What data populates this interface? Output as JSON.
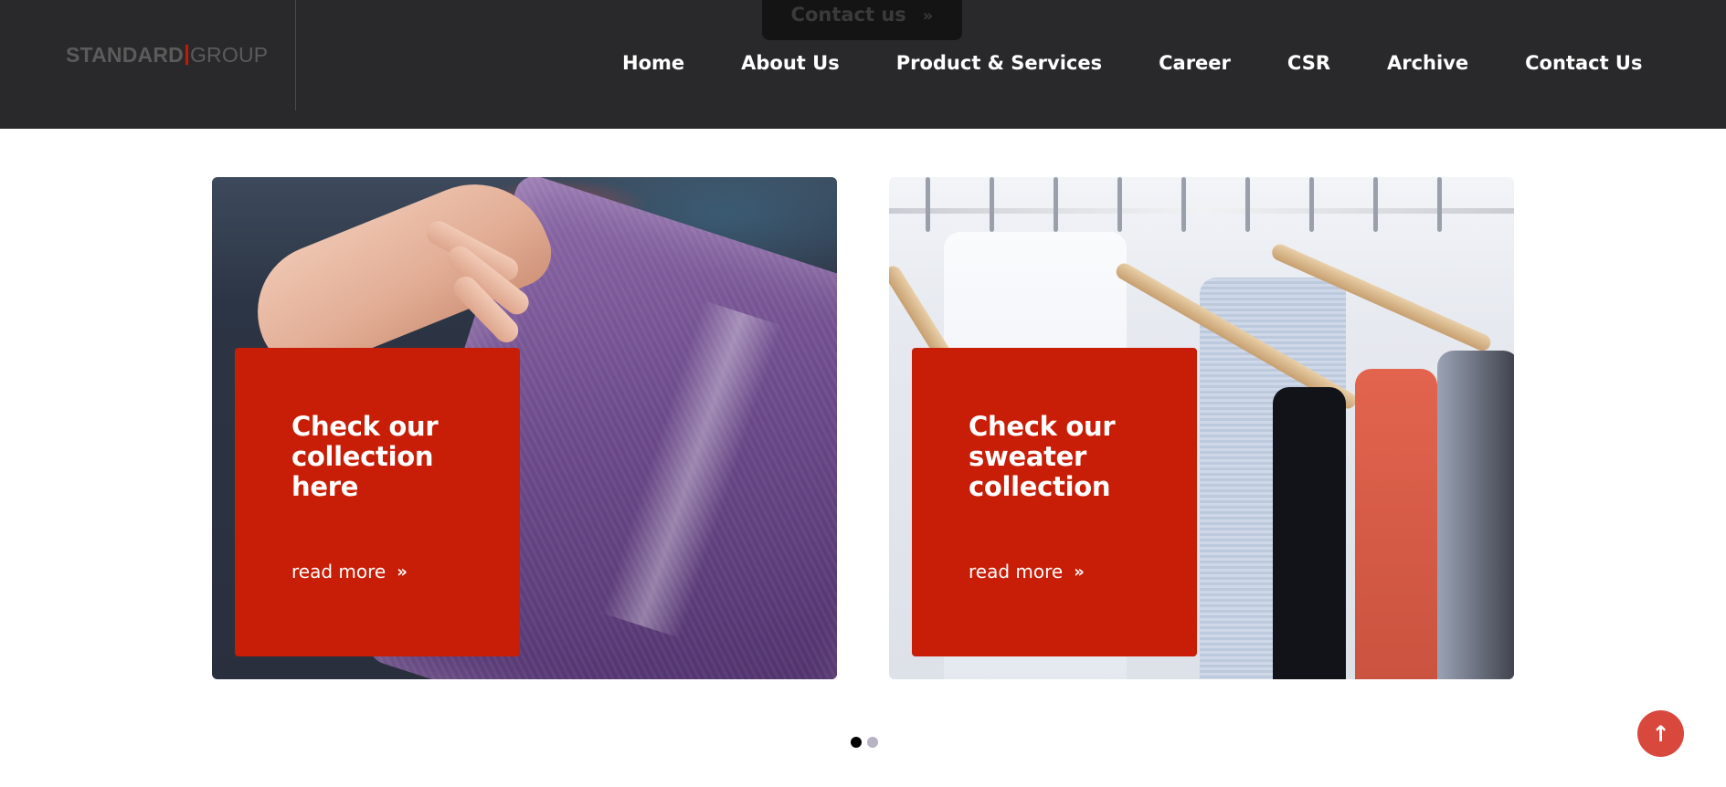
{
  "header": {
    "cta_label": "Contact us",
    "cta_icon": "double-chevron-right-icon",
    "logo": {
      "part1": "STANDARD",
      "part2": "GROUP"
    },
    "nav": [
      "Home",
      "About Us",
      "Product & Services",
      "Career",
      "CSR",
      "Archive",
      "Contact Us"
    ]
  },
  "cards": [
    {
      "title": "Check our collection here",
      "link_label": "read more",
      "link_icon": "double-chevron-right-icon"
    },
    {
      "title": "Check our sweater collection",
      "link_label": "read more",
      "link_icon": "double-chevron-right-icon"
    }
  ],
  "carousel": {
    "total_pages": 2,
    "active_page": 1
  },
  "scroll_top": {
    "icon": "arrow-up-icon"
  },
  "colors": {
    "header_bg": "#29292b",
    "accent_red": "#c81d06",
    "scroll_top_bg": "#d9483d"
  }
}
